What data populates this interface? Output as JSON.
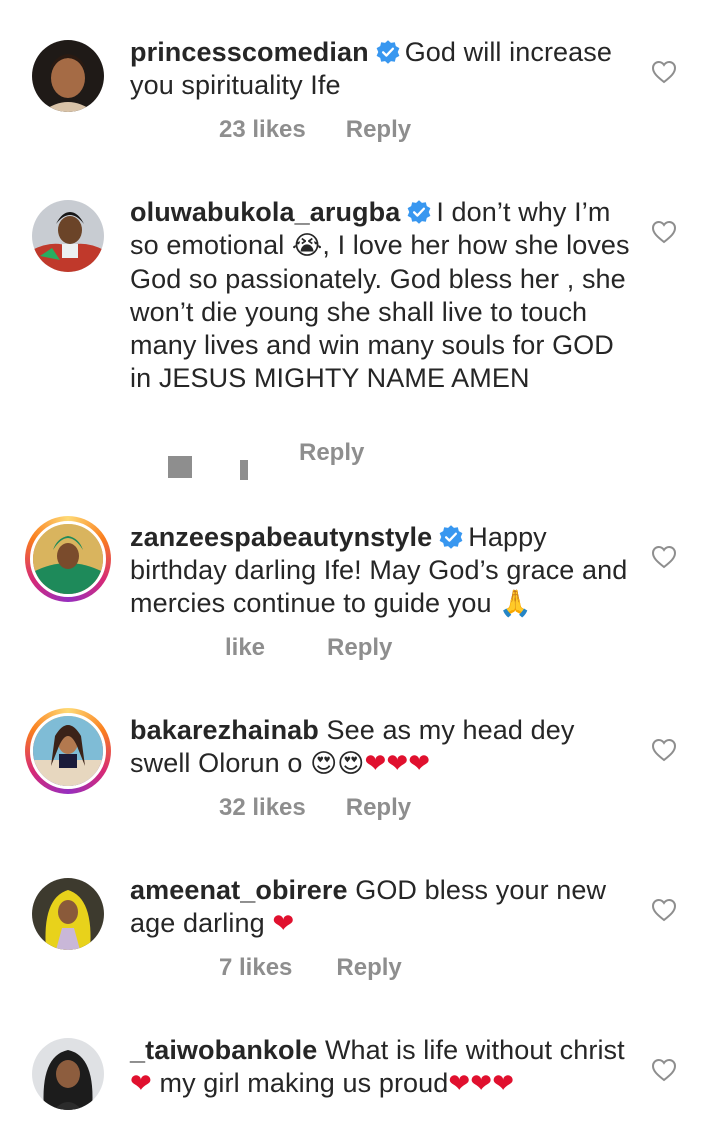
{
  "comments": [
    {
      "username": "princesscomedian",
      "verified": true,
      "text": "God will increase you spirituality Ife",
      "likes": "23 likes",
      "reply": "Reply"
    },
    {
      "username": "oluwabukola_arugba",
      "verified": true,
      "text_before_emoji": "I don’t why I’m so emotional ",
      "emoji": "😭",
      "text_after_emoji": ", I love her how she loves God so passionately. God bless her , she won’t die young she shall live to touch many lives and win many souls for GOD in JESUS MIGHTY NAME AMEN",
      "likes": "",
      "reply": "Reply"
    },
    {
      "username": "zanzeespabeautynstyle",
      "verified": true,
      "text": "Happy birthday darling Ife! May God’s grace and mercies continue to guide you ",
      "emoji": "🙏",
      "likes": "like",
      "reply": "Reply"
    },
    {
      "username": "bakarezhainab",
      "verified": false,
      "text": "See as my head dey swell Olorun o ",
      "emoji": "😍😍",
      "hearts": "❤❤❤",
      "likes": "32 likes",
      "reply": "Reply"
    },
    {
      "username": "ameenat_obirere",
      "verified": false,
      "text": "GOD bless your new age darling ",
      "hearts": "❤",
      "likes": "7 likes",
      "reply": "Reply"
    },
    {
      "username": "_taiwobankole",
      "verified": false,
      "text_a": "What is life without christ",
      "heart_a": "❤",
      "text_b": " my girl making us proud",
      "heart_b": "❤❤",
      "heart_c": "❤"
    }
  ],
  "colors": {
    "text": "#262626",
    "meta": "#8e8e8e",
    "verified": "#3897f0",
    "heart_red": "#e0102e"
  },
  "icons": {
    "verified": "verified-badge-icon",
    "like": "heart-outline-icon"
  }
}
